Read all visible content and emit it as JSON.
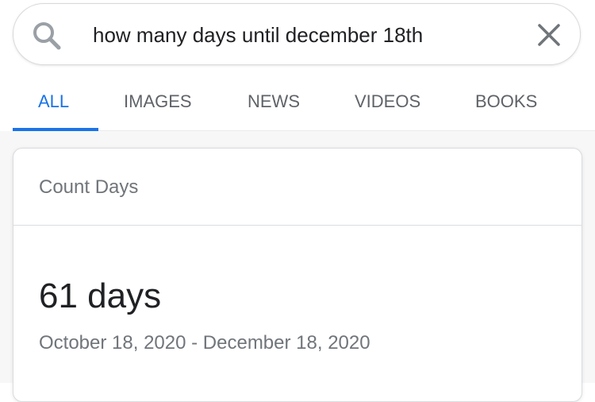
{
  "search": {
    "query": "how many days until december 18th",
    "search_icon": "search-icon",
    "clear_icon": "close-icon"
  },
  "tabs": [
    {
      "label": "ALL",
      "active": true
    },
    {
      "label": "IMAGES",
      "active": false
    },
    {
      "label": "NEWS",
      "active": false
    },
    {
      "label": "VIDEOS",
      "active": false
    },
    {
      "label": "BOOKS",
      "active": false
    }
  ],
  "card": {
    "title": "Count Days",
    "result": "61 days",
    "range": "October 18, 2020 - December 18, 2020"
  },
  "colors": {
    "accent": "#1a73e8",
    "text_primary": "#202124",
    "text_secondary": "#70757a"
  }
}
